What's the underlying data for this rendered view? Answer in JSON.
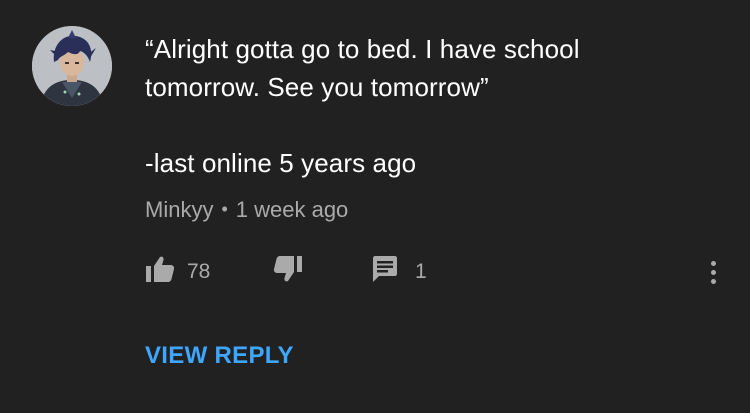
{
  "comment": {
    "line1": "“Alright gotta go to bed. I have school",
    "line2": "tomorrow. See you tomorrow”",
    "line3": "-last online 5 years ago"
  },
  "author": {
    "name": "Minkyy",
    "separator": "•",
    "timestamp": "1 week ago"
  },
  "actions": {
    "like_count": "78",
    "reply_count": "1",
    "like_icon": "thumbs-up-icon",
    "dislike_icon": "thumbs-down-icon",
    "reply_icon": "comment-icon",
    "more_icon": "more-vertical-icon"
  },
  "view_reply_label": "VIEW REPLY",
  "colors": {
    "background": "#212121",
    "text": "#ffffff",
    "secondary": "#aaaaaa",
    "link": "#3ea6ff"
  }
}
